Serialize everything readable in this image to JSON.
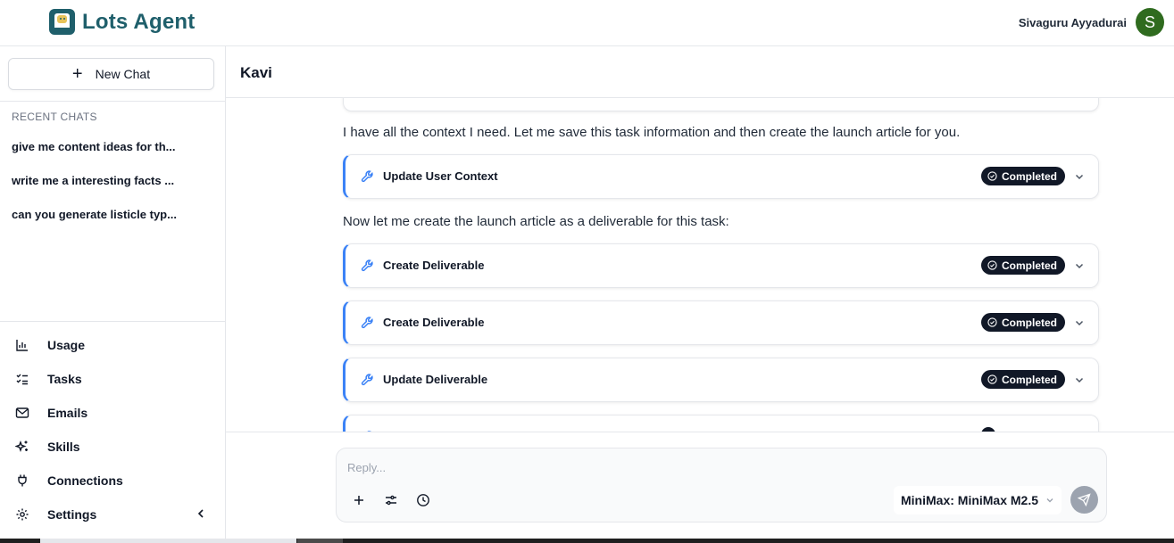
{
  "app": {
    "name": "Lots Agent",
    "user_name": "Sivaguru Ayyadurai",
    "user_initial": "S",
    "brand_color": "#1f5f6b",
    "avatar_color": "#2f6b1f"
  },
  "sidebar": {
    "new_chat_label": "New Chat",
    "recent_title": "RECENT CHATS",
    "recent_chats": [
      "give me content ideas for th...",
      "write me a interesting facts ...",
      "can you generate listicle typ..."
    ],
    "nav": [
      {
        "label": "Usage",
        "icon": "bar-chart-icon"
      },
      {
        "label": "Tasks",
        "icon": "list-checks-icon"
      },
      {
        "label": "Emails",
        "icon": "mail-icon"
      },
      {
        "label": "Skills",
        "icon": "sparkles-icon"
      },
      {
        "label": "Connections",
        "icon": "plug-icon"
      },
      {
        "label": "Settings",
        "icon": "gear-icon"
      }
    ]
  },
  "main": {
    "title": "Kavi",
    "messages": [
      "I have all the context I need. Let me save this task information and then create the launch article for you.",
      "Now let me create the launch article as a deliverable for this task:"
    ],
    "tool_calls": [
      {
        "label": "Update User Context",
        "status": "Completed"
      },
      {
        "label": "Create Deliverable",
        "status": "Completed"
      },
      {
        "label": "Create Deliverable",
        "status": "Completed"
      },
      {
        "label": "Update Deliverable",
        "status": "Completed"
      }
    ],
    "accent_color": "#3b82f6"
  },
  "composer": {
    "placeholder": "Reply...",
    "model": "MiniMax: MiniMax M2.5"
  }
}
